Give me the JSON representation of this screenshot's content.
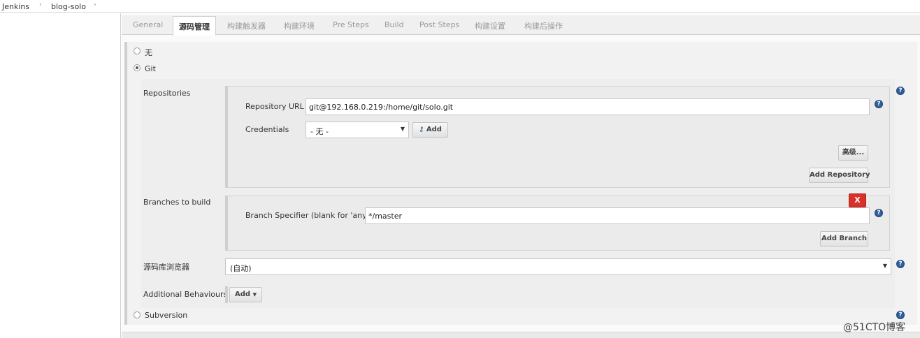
{
  "breadcrumb": {
    "items": [
      "Jenkins",
      "blog-solo"
    ]
  },
  "tabs": [
    "General",
    "源码管理",
    "构建触发器",
    "构建环境",
    "Pre Steps",
    "Build",
    "Post Steps",
    "构建设置",
    "构建后操作"
  ],
  "scm": {
    "option_none": "无",
    "option_git": "Git",
    "option_svn": "Subversion"
  },
  "repositories": {
    "section_label": "Repositories",
    "url_label": "Repository URL",
    "url_value": "git@192.168.0.219:/home/git/solo.git",
    "credentials_label": "Credentials",
    "credentials_value": "- 无 -",
    "add_credentials_label": "Add",
    "advanced_label": "高级...",
    "add_repository_label": "Add Repository"
  },
  "branches": {
    "section_label": "Branches to build",
    "delete_label": "X",
    "specifier_label": "Branch Specifier (blank for 'any')",
    "specifier_value": "*/master",
    "add_branch_label": "Add Branch"
  },
  "repo_browser": {
    "label": "源码库浏览器",
    "value": "(自动)"
  },
  "additional_behaviours": {
    "label": "Additional Behaviours",
    "add_label": "Add"
  },
  "watermark": "@51CTO博客",
  "help_glyph": "?",
  "colors": {
    "delete_red": "#d9302a",
    "help_blue": "#2f5f9e"
  }
}
